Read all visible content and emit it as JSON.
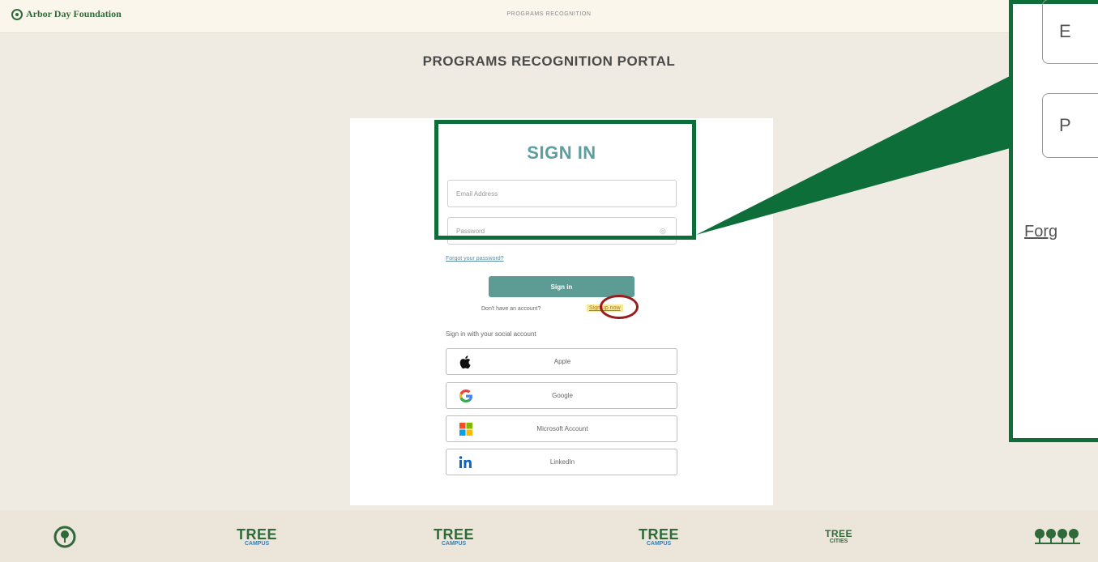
{
  "header": {
    "brand": "Arbor Day Foundation",
    "center_title": "PROGRAMS RECOGNITION"
  },
  "page": {
    "title": "PROGRAMS RECOGNITION PORTAL"
  },
  "signin": {
    "title": "SIGN IN",
    "email_placeholder": "Email Address",
    "password_placeholder": "Password",
    "forgot_link": "Forgot your password?",
    "submit_label": "Sign in",
    "no_account_text": "Don't have an account?",
    "signup_link": "Sign up now"
  },
  "social": {
    "label": "Sign in with your social account",
    "providers": [
      {
        "label": "Apple",
        "icon": "apple-icon"
      },
      {
        "label": "Google",
        "icon": "google-icon"
      },
      {
        "label": "Microsoft Account",
        "icon": "microsoft-icon"
      },
      {
        "label": "LinkedIn",
        "icon": "linkedin-icon"
      }
    ]
  },
  "zoom_callout": {
    "email_fragment": "E",
    "password_fragment": "P",
    "forgot_fragment": "Forg"
  },
  "footer": {
    "logos": [
      {
        "name": "tree-city-usa-logo",
        "line1": "",
        "line2": ""
      },
      {
        "name": "tree-campus-healthcare-logo",
        "line1": "TREE",
        "line2": "CAMPUS"
      },
      {
        "name": "tree-campus-higher-ed-logo",
        "line1": "TREE",
        "line2": "CAMPUS"
      },
      {
        "name": "tree-campus-k12-logo",
        "line1": "TREE",
        "line2": "CAMPUS"
      },
      {
        "name": "tree-cities-world-logo",
        "line1": "TREE",
        "line2": "CITIES"
      },
      {
        "name": "tree-line-usa-logo",
        "line1": "",
        "line2": ""
      }
    ]
  },
  "colors": {
    "accent_teal": "#5b9fa3",
    "button": "#5d9c94",
    "highlight_green": "#0d6e3a",
    "circle_red": "#9a1c1c"
  }
}
